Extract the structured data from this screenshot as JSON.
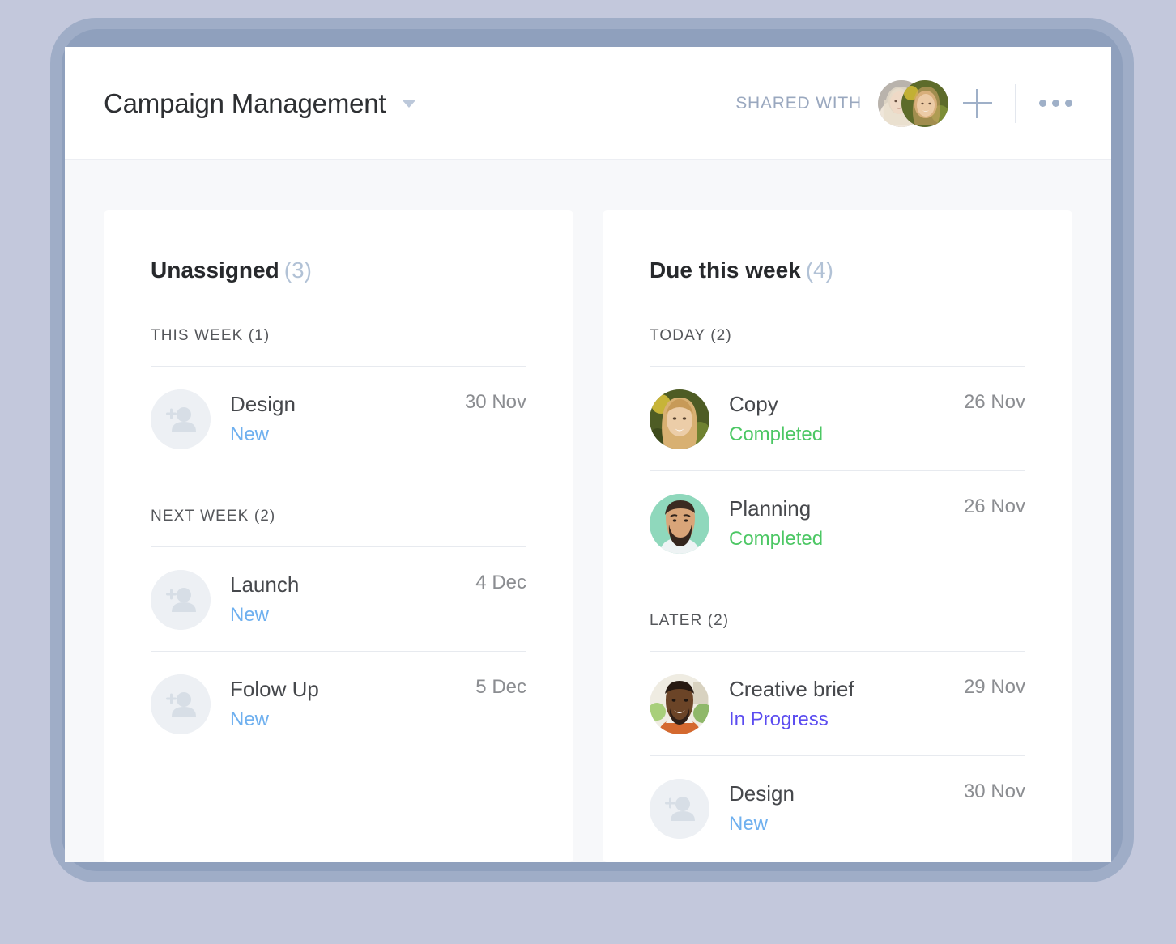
{
  "header": {
    "title": "Campaign Management",
    "caret_icon": "chevron-down-icon",
    "shared_with_label": "SHARED WITH",
    "add_icon": "plus-icon",
    "more_icon": "more-horizontal-icon",
    "avatars": [
      {
        "name": "avatar-blonde-woman-1"
      },
      {
        "name": "avatar-blonde-woman-2"
      }
    ]
  },
  "colors": {
    "status_new": "#6fb0ef",
    "status_completed": "#4cc764",
    "status_in_progress": "#5b4cf0",
    "title_count": "#b2c2d6",
    "page_background": "#f7f8fa",
    "frame": "#8fa0bd"
  },
  "columns": [
    {
      "title": "Unassigned",
      "count": "(3)",
      "sections": [
        {
          "label": "THIS WEEK (1)",
          "tasks": [
            {
              "name": "Design",
              "status": "New",
              "status_kind": "new",
              "date": "30 Nov",
              "avatar": "add-person-placeholder"
            }
          ]
        },
        {
          "label": "NEXT WEEK (2)",
          "tasks": [
            {
              "name": "Launch",
              "status": "New",
              "status_kind": "new",
              "date": "4 Dec",
              "avatar": "add-person-placeholder"
            },
            {
              "name": "Folow Up",
              "status": "New",
              "status_kind": "new",
              "date": "5 Dec",
              "avatar": "add-person-placeholder"
            }
          ]
        }
      ]
    },
    {
      "title": "Due this week",
      "count": "(4)",
      "sections": [
        {
          "label": "TODAY (2)",
          "tasks": [
            {
              "name": "Copy",
              "status": "Completed",
              "status_kind": "completed",
              "date": "26 Nov",
              "avatar": "photo-blonde-woman"
            },
            {
              "name": "Planning",
              "status": "Completed",
              "status_kind": "completed",
              "date": "26 Nov",
              "avatar": "photo-bearded-man"
            }
          ]
        },
        {
          "label": "LATER (2)",
          "tasks": [
            {
              "name": "Creative brief",
              "status": "In Progress",
              "status_kind": "inprogress",
              "date": "29 Nov",
              "avatar": "photo-smiling-man"
            },
            {
              "name": "Design",
              "status": "New",
              "status_kind": "new",
              "date": "30 Nov",
              "avatar": "add-person-placeholder"
            }
          ]
        }
      ]
    }
  ]
}
